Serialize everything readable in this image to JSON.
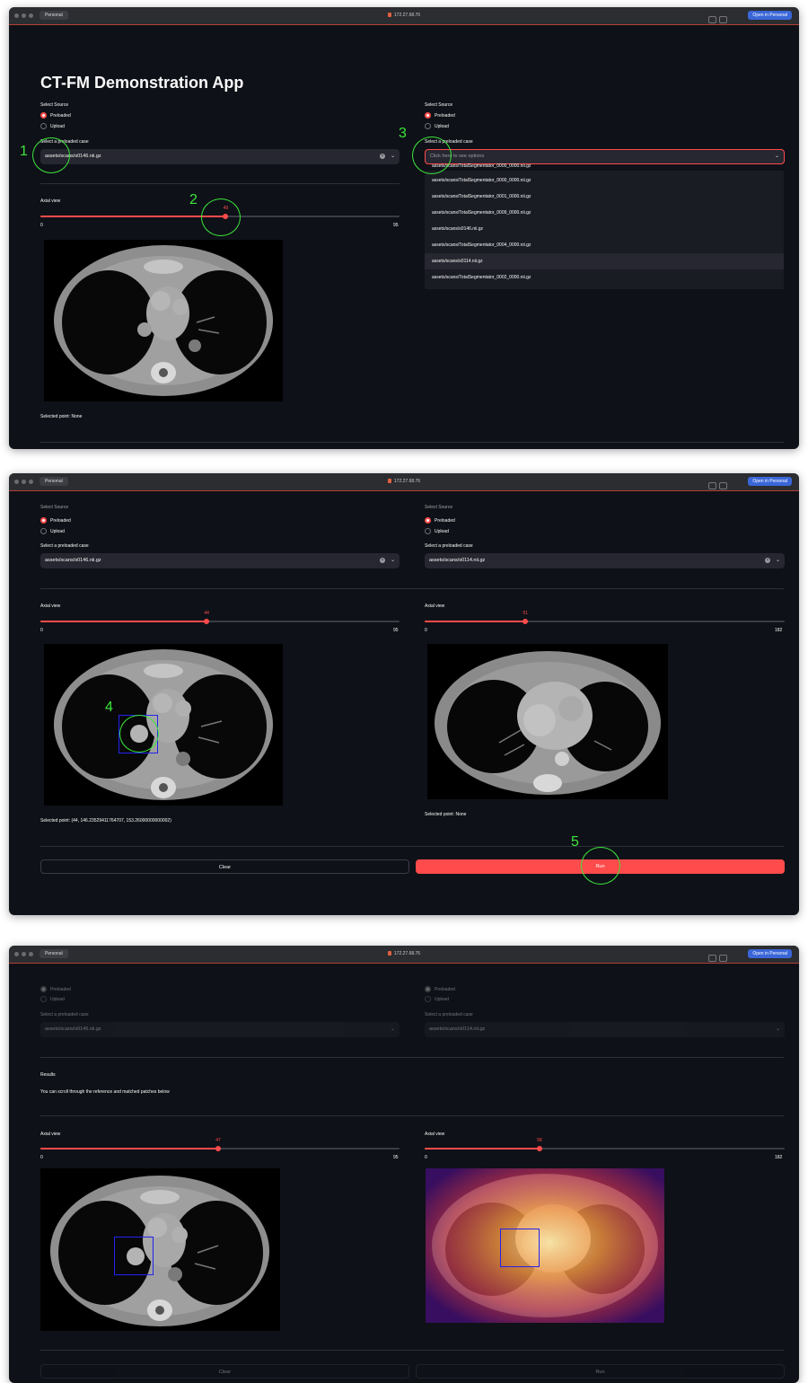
{
  "browser": {
    "profile": "Personal",
    "url": "172.27.68.76",
    "open_in": "Open in Personal"
  },
  "app": {
    "title": "CT-FM Demonstration App"
  },
  "labels": {
    "select_source": "Select Source",
    "preloaded": "Preloaded",
    "upload": "Upload",
    "select_case": "Select a preloaded case",
    "axial_view": "Axial view",
    "selected_point_none": "Selected point: None",
    "clear": "Clear",
    "run": "Run",
    "results": "Results",
    "results_desc": "You can scroll through the reference and matched patches below"
  },
  "step1": {
    "left_case": "assets/scans/s0146.nii.gz",
    "right_placeholder": "Click here to see options",
    "left_slider": {
      "min": "0",
      "max": "95",
      "value": "49"
    },
    "dropdown_options": [
      "assets/scans/TotalSegmentator_0000_0000.nii.gz",
      "assets/scans/TotalSegmentator_0001_0000.nii.gz",
      "assets/scans/TotalSegmentator_0009_0000.nii.gz",
      "assets/scans/s0146.nii.gz",
      "assets/scans/TotalSegmentator_0004_0000.nii.gz",
      "assets/scans/s0114.nii.gz",
      "assets/scans/TotalSegmentator_0002_0000.nii.gz"
    ],
    "dropdown_partial": "assets/scans/TotalSegmentator_0000_0000.nii.gz",
    "highlighted_index": 5
  },
  "step2": {
    "left_case": "assets/scans/s0146.nii.gz",
    "right_case": "assets/scans/s0114.nii.gz",
    "left_slider": {
      "min": "0",
      "max": "95",
      "value": "44"
    },
    "right_slider": {
      "min": "0",
      "max": "182",
      "value": "51"
    },
    "left_point": "Selected point: (44, 146.23529411764707, 153.26000000000002)",
    "right_point": "Selected point: None"
  },
  "step3": {
    "left_case": "assets/scans/s0146.nii.gz",
    "right_case": "assets/scans/s0114.nii.gz",
    "left_slider": {
      "min": "0",
      "max": "95",
      "value": "47"
    },
    "right_slider": {
      "min": "0",
      "max": "182",
      "value": "58"
    }
  },
  "callouts": [
    "1",
    "2",
    "3",
    "4",
    "5"
  ],
  "colors": {
    "background": "#0e1117",
    "accent": "#ff4b4b",
    "widget": "#262730",
    "callout": "#3ce63c",
    "bbox": "#2222ee"
  }
}
